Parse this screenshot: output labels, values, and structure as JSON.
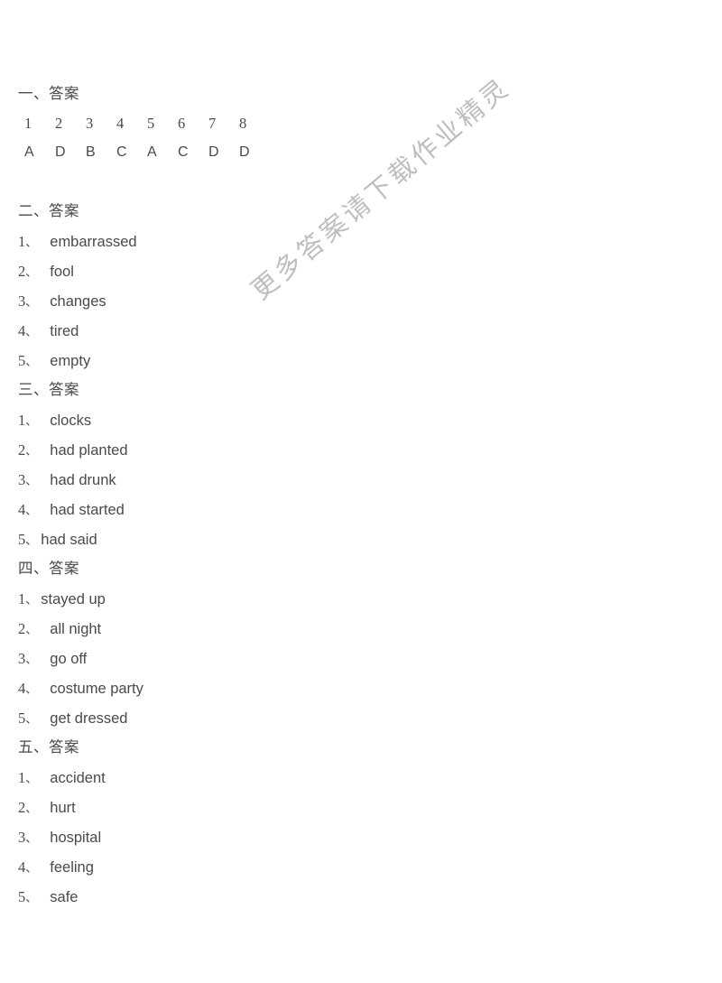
{
  "document": {
    "watermark": "更多答案请下载作业精灵",
    "watermark_color": "#bbbbbb",
    "text_color": "#4a4a4a",
    "background_color": "#ffffff"
  },
  "sections": [
    {
      "heading": "一、答案",
      "type": "choice_table",
      "numbers": [
        "1",
        "2",
        "3",
        "4",
        "5",
        "6",
        "7",
        "8"
      ],
      "answers": [
        "A",
        "D",
        "B",
        "C",
        "A",
        "C",
        "D",
        "D"
      ]
    },
    {
      "heading": "二、答案",
      "type": "numbered_list",
      "items": [
        {
          "num": "1",
          "sep": "、",
          "text": "embarrassed",
          "gap": 2
        },
        {
          "num": "2",
          "sep": "、",
          "text": "fool",
          "gap": 2
        },
        {
          "num": "3",
          "sep": "、",
          "text": "changes",
          "gap": 2
        },
        {
          "num": "4",
          "sep": "、",
          "text": "tired",
          "gap": 2
        },
        {
          "num": "5",
          "sep": "、",
          "text": "empty",
          "gap": 2
        }
      ]
    },
    {
      "heading": "三、答案",
      "type": "numbered_list",
      "items": [
        {
          "num": "1",
          "sep": "、",
          "text": "clocks",
          "gap": 2
        },
        {
          "num": "2",
          "sep": "、",
          "text": "had planted",
          "gap": 2
        },
        {
          "num": "3",
          "sep": "、",
          "text": "had drunk",
          "gap": 2
        },
        {
          "num": "4",
          "sep": "、",
          "text": "had started",
          "gap": 2
        },
        {
          "num": "5",
          "sep": "、",
          "text": "had said",
          "gap": 0
        }
      ]
    },
    {
      "heading": "四、答案",
      "type": "numbered_list",
      "items": [
        {
          "num": "1",
          "sep": "、",
          "text": "stayed up",
          "gap": 0
        },
        {
          "num": "2",
          "sep": "、",
          "text": "all night",
          "gap": 2
        },
        {
          "num": "3",
          "sep": "、",
          "text": "go off",
          "gap": 2
        },
        {
          "num": "4",
          "sep": "、",
          "text": "costume party",
          "gap": 2
        },
        {
          "num": "5",
          "sep": "、",
          "text": "get dressed",
          "gap": 2
        }
      ]
    },
    {
      "heading": "五、答案",
      "type": "numbered_list",
      "items": [
        {
          "num": "1",
          "sep": "、",
          "text": "accident",
          "gap": 2
        },
        {
          "num": "2",
          "sep": "、",
          "text": "hurt",
          "gap": 2
        },
        {
          "num": "3",
          "sep": "、",
          "text": "hospital",
          "gap": 2
        },
        {
          "num": "4",
          "sep": "、",
          "text": "feeling",
          "gap": 2
        },
        {
          "num": "5",
          "sep": "、",
          "text": "safe",
          "gap": 2
        }
      ]
    }
  ]
}
